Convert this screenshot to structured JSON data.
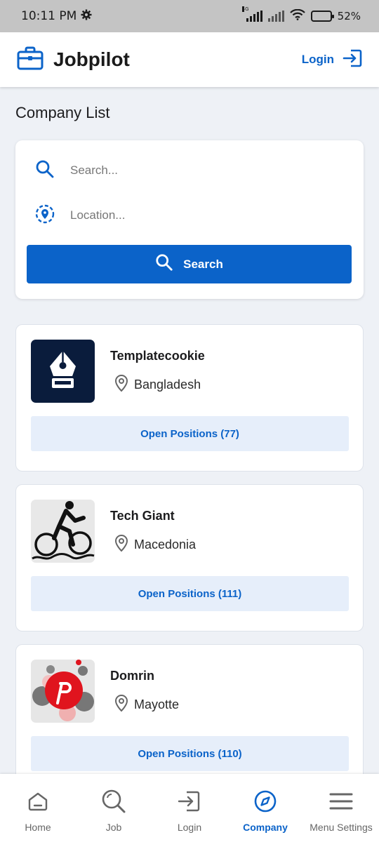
{
  "status_bar": {
    "time": "10:11 PM",
    "network": "4G",
    "battery": "52%"
  },
  "header": {
    "brand": "Jobpilot",
    "login_label": "Login"
  },
  "page": {
    "title": "Company List"
  },
  "search": {
    "keyword_placeholder": "Search...",
    "location_placeholder": "Location...",
    "button_label": "Search"
  },
  "companies": [
    {
      "name": "Templatecookie",
      "location": "Bangladesh",
      "open_positions": "Open Positions (77)"
    },
    {
      "name": "Tech Giant",
      "location": "Macedonia",
      "open_positions": "Open Positions (111)"
    },
    {
      "name": "Domrin",
      "location": "Mayotte",
      "open_positions": "Open Positions (110)"
    }
  ],
  "bottom_nav": [
    {
      "label": "Home",
      "icon": "home-icon",
      "active": false
    },
    {
      "label": "Job",
      "icon": "search-icon",
      "active": false
    },
    {
      "label": "Login",
      "icon": "login-icon",
      "active": false
    },
    {
      "label": "Company",
      "icon": "compass-icon",
      "active": true
    },
    {
      "label": "Menu Settings",
      "icon": "menu-icon",
      "active": false
    }
  ],
  "colors": {
    "accent": "#0b63c9",
    "background": "#eef1f6",
    "button_soft": "#e6eefa"
  }
}
